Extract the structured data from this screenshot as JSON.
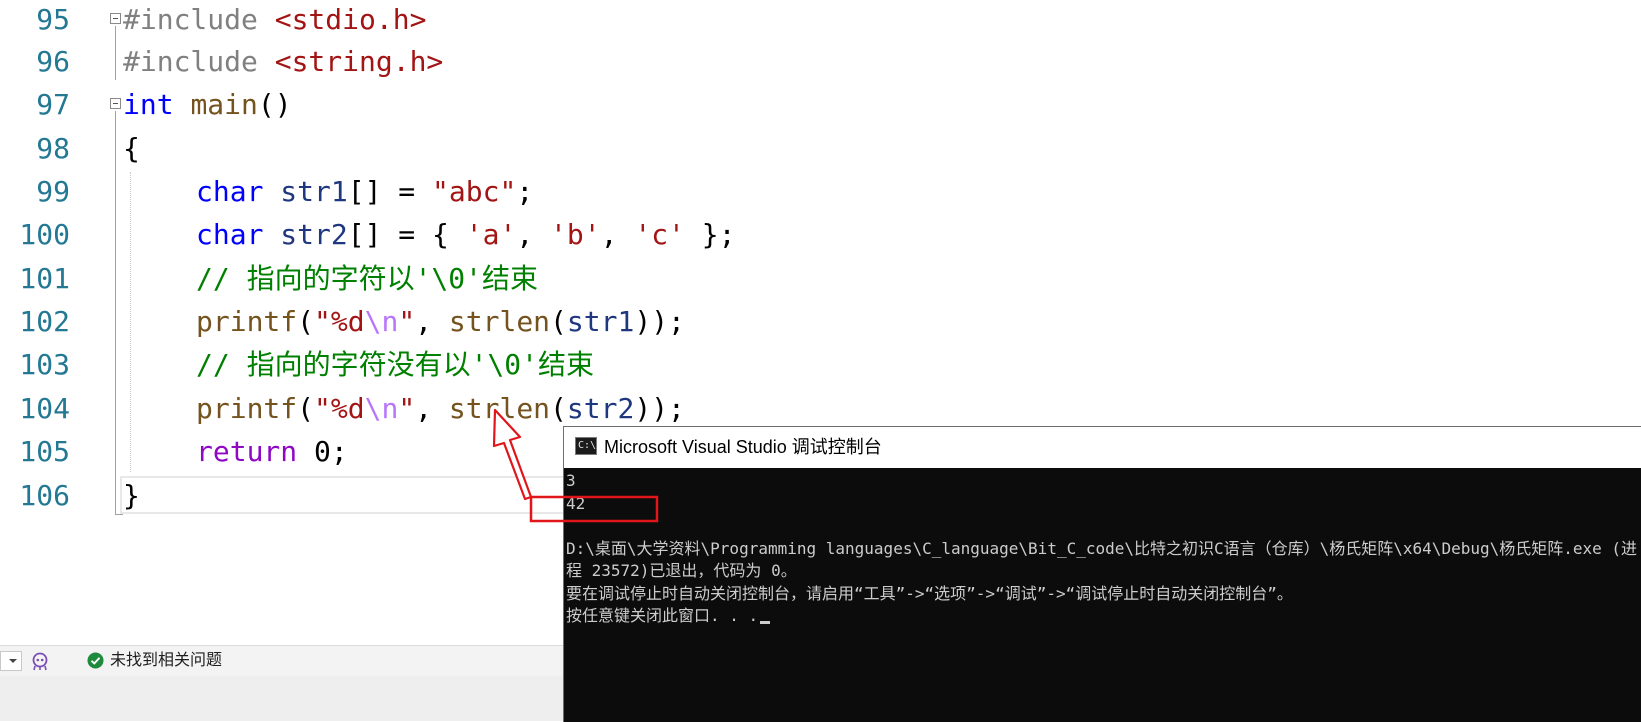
{
  "editor": {
    "line_numbers": [
      "95",
      "96",
      "97",
      "98",
      "99",
      "100",
      "101",
      "102",
      "103",
      "104",
      "105",
      "106"
    ],
    "code": {
      "l95": {
        "pp": "#include",
        "hdr": "<stdio.h>"
      },
      "l96": {
        "pp": "#include",
        "hdr": "<string.h>"
      },
      "l97": {
        "kw": "int",
        "fn": "main",
        "rest": "()"
      },
      "l98": {
        "text": "{"
      },
      "l99": {
        "kw": "char",
        "var": "str1",
        "mid": "[] = ",
        "str": "\"abc\"",
        "end": ";"
      },
      "l100": {
        "kw": "char",
        "var": "str2",
        "mid": "[] = { ",
        "c1": "'a'",
        "s1": ", ",
        "c2": "'b'",
        "s2": ", ",
        "c3": "'c'",
        "end": " };"
      },
      "l101": {
        "comment": "// 指向的字符以'\\0'结束"
      },
      "l102": {
        "fn": "printf",
        "p1": "(",
        "q1": "\"%d",
        "esc": "\\n",
        "q2": "\"",
        "sep": ", ",
        "fn2": "strlen",
        "p2": "(",
        "var": "str1",
        "end": "));"
      },
      "l103": {
        "comment": "// 指向的字符没有以'\\0'结束"
      },
      "l104": {
        "fn": "printf",
        "p1": "(",
        "q1": "\"%d",
        "esc": "\\n",
        "q2": "\"",
        "sep": ", ",
        "fn2": "strlen",
        "p2": "(",
        "var": "str2",
        "end": "));"
      },
      "l105": {
        "kw": "return",
        "rest": " 0;"
      },
      "l106": {
        "text": "}"
      }
    }
  },
  "statusbar": {
    "issues_text": "未找到相关问题",
    "icons": [
      "zoom-dropdown",
      "copilot-icon",
      "check-circle-icon"
    ]
  },
  "console": {
    "title": "Microsoft Visual Studio 调试控制台",
    "icon_label": "C:\\",
    "lines": [
      "3",
      "42",
      "",
      "D:\\桌面\\大学资料\\Programming languages\\C_language\\Bit_C_code\\比特之初识C语言（仓库）\\杨氏矩阵\\x64\\Debug\\杨氏矩阵.exe (进",
      "程 23572)已退出，代码为 0。",
      "要在调试停止时自动关闭控制台，请启用“工具”->“选项”->“调试”->“调试停止时自动关闭控制台”。",
      "按任意键关闭此窗口. . ."
    ]
  },
  "colors": {
    "keyword": "#0000ff",
    "string": "#a31515",
    "comment": "#008000",
    "function": "#74531f",
    "variable": "#1f377f",
    "line_number": "#237893",
    "annotation": "#e0161b"
  }
}
